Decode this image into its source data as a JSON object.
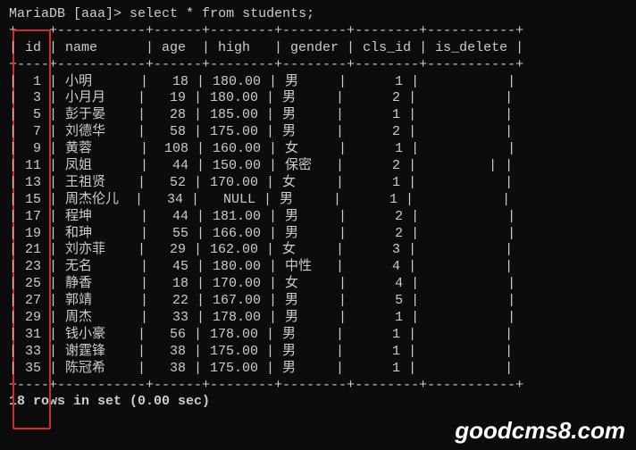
{
  "prompt": {
    "prefix": "MariaDB [aaa]>",
    "query": "select * from students;"
  },
  "separator_top": "+----+-----------+------+--------+--------+--------+-----------+",
  "header_row": "| id | name      | age  | high   | gender | cls_id | is_delete |",
  "separator_mid": "+----+-----------+------+--------+--------+--------+-----------+",
  "data_rows": [
    "|  1 | 小明      |   18 | 180.00 | 男     |      1 |           |",
    "|  3 | 小月月    |   19 | 180.00 | 男     |      2 |           |",
    "|  5 | 彭于晏    |   28 | 185.00 | 男     |      1 |           |",
    "|  7 | 刘德华    |   58 | 175.00 | 男     |      2 |           |",
    "|  9 | 黄蓉      |  108 | 160.00 | 女     |      1 |           |",
    "| 11 | 凤姐      |   44 | 150.00 | 保密   |      2 |         | |",
    "| 13 | 王祖贤    |   52 | 170.00 | 女     |      1 |           |",
    "| 15 | 周杰伦儿  |   34 |   NULL | 男     |      1 |           |",
    "| 17 | 程坤      |   44 | 181.00 | 男     |      2 |           |",
    "| 19 | 和珅      |   55 | 166.00 | 男     |      2 |           |",
    "| 21 | 刘亦菲    |   29 | 162.00 | 女     |      3 |           |",
    "| 23 | 无名      |   45 | 180.00 | 中性   |      4 |           |",
    "| 25 | 静香      |   18 | 170.00 | 女     |      4 |           |",
    "| 27 | 郭靖      |   22 | 167.00 | 男     |      5 |           |",
    "| 29 | 周杰      |   33 | 178.00 | 男     |      1 |           |",
    "| 31 | 钱小豪    |   56 | 178.00 | 男     |      1 |           |",
    "| 33 | 谢霆锋    |   38 | 175.00 | 男     |      1 |           |",
    "| 35 | 陈冠希    |   38 | 175.00 | 男     |      1 |           |"
  ],
  "separator_bot": "+----+-----------+------+--------+--------+--------+-----------+",
  "status": "18 rows in set (0.00 sec)",
  "watermark": "goodcms8.com",
  "chart_data": {
    "type": "table",
    "title": "students",
    "columns": [
      "id",
      "name",
      "age",
      "high",
      "gender",
      "cls_id",
      "is_delete"
    ],
    "rows": [
      {
        "id": 1,
        "name": "小明",
        "age": 18,
        "high": 180.0,
        "gender": "男",
        "cls_id": 1,
        "is_delete": ""
      },
      {
        "id": 3,
        "name": "小月月",
        "age": 19,
        "high": 180.0,
        "gender": "男",
        "cls_id": 2,
        "is_delete": ""
      },
      {
        "id": 5,
        "name": "彭于晏",
        "age": 28,
        "high": 185.0,
        "gender": "男",
        "cls_id": 1,
        "is_delete": ""
      },
      {
        "id": 7,
        "name": "刘德华",
        "age": 58,
        "high": 175.0,
        "gender": "男",
        "cls_id": 2,
        "is_delete": ""
      },
      {
        "id": 9,
        "name": "黄蓉",
        "age": 108,
        "high": 160.0,
        "gender": "女",
        "cls_id": 1,
        "is_delete": ""
      },
      {
        "id": 11,
        "name": "凤姐",
        "age": 44,
        "high": 150.0,
        "gender": "保密",
        "cls_id": 2,
        "is_delete": ""
      },
      {
        "id": 13,
        "name": "王祖贤",
        "age": 52,
        "high": 170.0,
        "gender": "女",
        "cls_id": 1,
        "is_delete": ""
      },
      {
        "id": 15,
        "name": "周杰伦儿",
        "age": 34,
        "high": null,
        "gender": "男",
        "cls_id": 1,
        "is_delete": ""
      },
      {
        "id": 17,
        "name": "程坤",
        "age": 44,
        "high": 181.0,
        "gender": "男",
        "cls_id": 2,
        "is_delete": ""
      },
      {
        "id": 19,
        "name": "和珅",
        "age": 55,
        "high": 166.0,
        "gender": "男",
        "cls_id": 2,
        "is_delete": ""
      },
      {
        "id": 21,
        "name": "刘亦菲",
        "age": 29,
        "high": 162.0,
        "gender": "女",
        "cls_id": 3,
        "is_delete": ""
      },
      {
        "id": 23,
        "name": "无名",
        "age": 45,
        "high": 180.0,
        "gender": "中性",
        "cls_id": 4,
        "is_delete": ""
      },
      {
        "id": 25,
        "name": "静香",
        "age": 18,
        "high": 170.0,
        "gender": "女",
        "cls_id": 4,
        "is_delete": ""
      },
      {
        "id": 27,
        "name": "郭靖",
        "age": 22,
        "high": 167.0,
        "gender": "男",
        "cls_id": 5,
        "is_delete": ""
      },
      {
        "id": 29,
        "name": "周杰",
        "age": 33,
        "high": 178.0,
        "gender": "男",
        "cls_id": 1,
        "is_delete": ""
      },
      {
        "id": 31,
        "name": "钱小豪",
        "age": 56,
        "high": 178.0,
        "gender": "男",
        "cls_id": 1,
        "is_delete": ""
      },
      {
        "id": 33,
        "name": "谢霆锋",
        "age": 38,
        "high": 175.0,
        "gender": "男",
        "cls_id": 1,
        "is_delete": ""
      },
      {
        "id": 35,
        "name": "陈冠希",
        "age": 38,
        "high": 175.0,
        "gender": "男",
        "cls_id": 1,
        "is_delete": ""
      }
    ]
  }
}
